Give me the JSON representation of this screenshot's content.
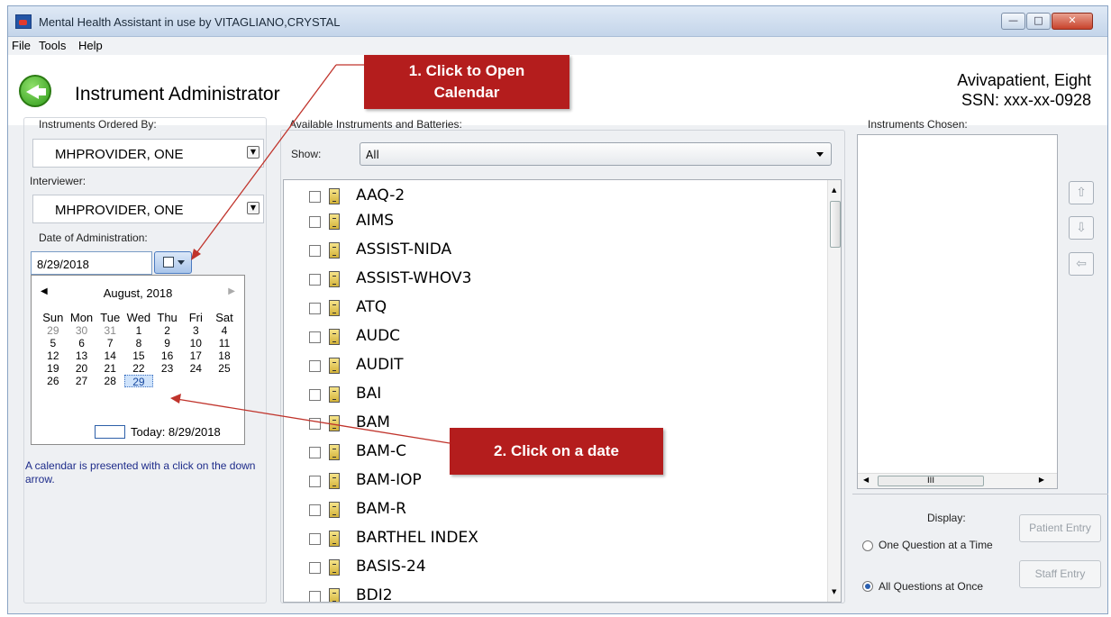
{
  "window": {
    "title": "Mental Health Assistant in use by VITAGLIANO,CRYSTAL"
  },
  "menu": [
    "File",
    "Tools",
    "Help"
  ],
  "header": {
    "title": "Instrument Administrator",
    "patient_name": "Avivapatient, Eight",
    "patient_ssn": "SSN: xxx-xx-0928"
  },
  "callouts": {
    "step1": "1. Click to Open\nCalendar",
    "step1_line1": "1. Click to Open",
    "step1_line2": "Calendar",
    "step2": "2. Click on a date"
  },
  "left": {
    "ordered_by_label": "Instruments Ordered By:",
    "ordered_by_value": "MHPROVIDER, ONE",
    "interviewer_label": "Interviewer:",
    "interviewer_value": "MHPROVIDER, ONE",
    "date_label": "Date of Administration:",
    "date_value": "8/29/2018",
    "hint": "A calendar is presented with a click on the down arrow."
  },
  "calendar": {
    "month": "August, 2018",
    "days": [
      "Sun",
      "Mon",
      "Tue",
      "Wed",
      "Thu",
      "Fri",
      "Sat"
    ],
    "weeks": [
      [
        "29",
        "30",
        "31",
        "1",
        "2",
        "3",
        "4"
      ],
      [
        "5",
        "6",
        "7",
        "8",
        "9",
        "10",
        "11"
      ],
      [
        "12",
        "13",
        "14",
        "15",
        "16",
        "17",
        "18"
      ],
      [
        "19",
        "20",
        "21",
        "22",
        "23",
        "24",
        "25"
      ],
      [
        "26",
        "27",
        "28",
        "29",
        "",
        "",
        ""
      ]
    ],
    "selected": "29",
    "today": "Today: 8/29/2018"
  },
  "middle": {
    "label": "Available Instruments and Batteries:",
    "show_label": "Show:",
    "show_value": "All",
    "instruments": [
      "AAQ-2",
      "AIMS",
      "ASSIST-NIDA",
      "ASSIST-WHOV3",
      "ATQ",
      "AUDC",
      "AUDIT",
      "BAI",
      "BAM",
      "BAM-C",
      "BAM-IOP",
      "BAM-R",
      "BARTHEL INDEX",
      "BASIS-24",
      "BDI2"
    ]
  },
  "right": {
    "label": "Instruments Chosen:",
    "display_label": "Display:",
    "option_one": "One Question at a Time",
    "option_all": "All Questions at Once",
    "patient_entry": "Patient Entry",
    "staff_entry": "Staff Entry"
  }
}
